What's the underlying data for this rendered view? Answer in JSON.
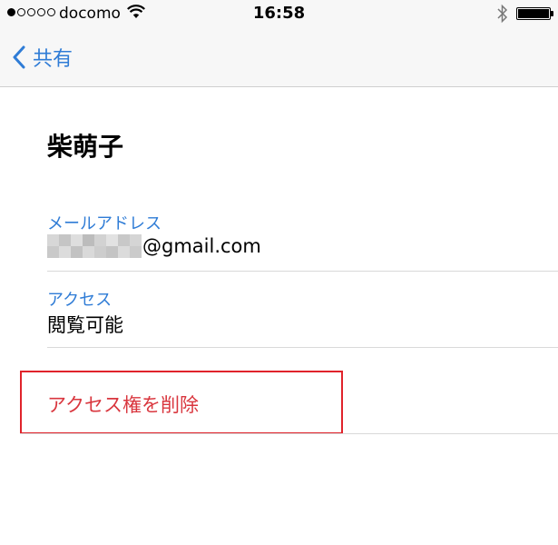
{
  "status_bar": {
    "carrier": "docomo",
    "time": "16:58",
    "signal_bars": 1,
    "signal_total": 5,
    "battery_level": 1.0
  },
  "nav": {
    "back_label": "共有"
  },
  "person": {
    "name": "柴萌子"
  },
  "fields": {
    "email_label": "メールアドレス",
    "email_visible": "@gmail.com",
    "access_label": "アクセス",
    "access_value": "閲覧可能"
  },
  "actions": {
    "remove_access_label": "アクセス権を削除"
  },
  "colors": {
    "accent": "#2f7cd6",
    "destructive": "#d9363e",
    "highlight_border": "#e0232b"
  }
}
